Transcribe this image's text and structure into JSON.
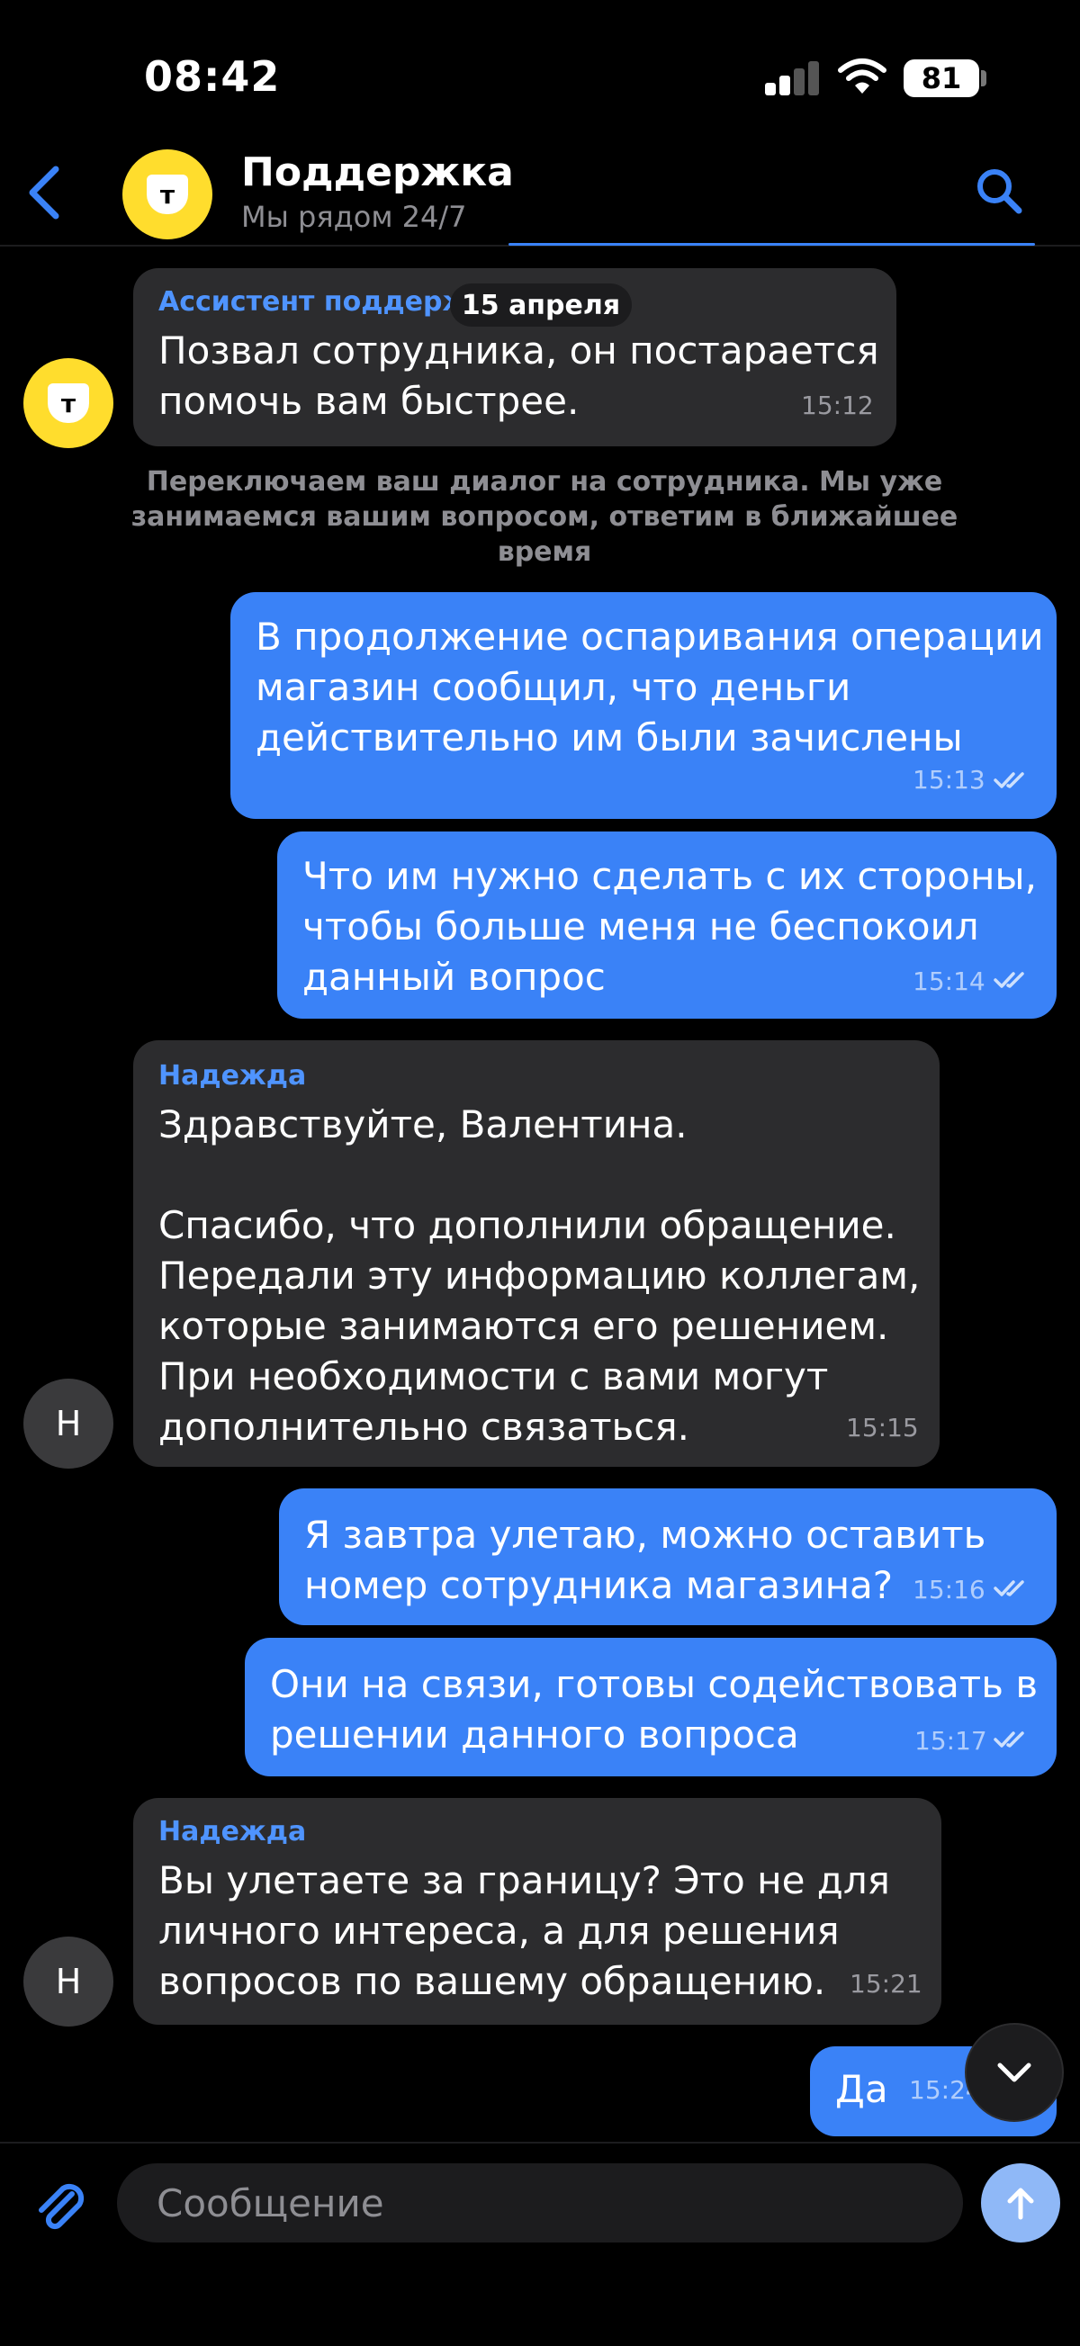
{
  "status_bar": {
    "time": "08:42",
    "battery": "81"
  },
  "header": {
    "title": "Поддержка",
    "subtitle": "Мы рядом 24/7",
    "avatar_letter": "т"
  },
  "date_label": "15 апреля",
  "system_message": "Переключаем ваш диалог на сотрудника. Мы уже занимаемся вашим вопросом, ответим в ближайшее время",
  "messages": [
    {
      "author": "Ассистент поддержки",
      "text": "Позвал сотрудника, он постарается\nпомочь вам быстрее.",
      "time": "15:12",
      "avatar": "т"
    },
    {
      "text": "В продолжение оспаривания операции\nмагазин сообщил, что деньги\nдействительно им были зачислены",
      "time": "15:13"
    },
    {
      "text": "Что им нужно сделать с их стороны,\nчтобы больше меня не беспокоил\nданный вопрос",
      "time": "15:14"
    },
    {
      "author": "Надежда",
      "text": "Здравствуйте, Валентина.\n\nСпасибо, что дополнили обращение.\nПередали эту информацию коллегам,\nкоторые занимаются его решением.\nПри необходимости с вами могут\nдополнительно связаться.",
      "time": "15:15",
      "avatar": "Н"
    },
    {
      "text": "Я завтра улетаю, можно оставить\nномер сотрудника магазина?",
      "time": "15:16"
    },
    {
      "text": "Они на связи, готовы содействовать в\nрешении данного вопроса",
      "time": "15:17"
    },
    {
      "author": "Надежда",
      "text": "Вы улетаете за границу? Это не для\nличного интереса, а для решения\nвопросов по вашему обращению.",
      "time": "15:21",
      "avatar": "Н"
    },
    {
      "text": "Да",
      "time": "15:24"
    }
  ],
  "composer": {
    "placeholder": "Сообщение"
  },
  "colors": {
    "accent": "#3a82f7",
    "brand_yellow": "#ffdd2d",
    "incoming_bubble": "#2c2c2e",
    "author_name": "#4f94ff"
  }
}
